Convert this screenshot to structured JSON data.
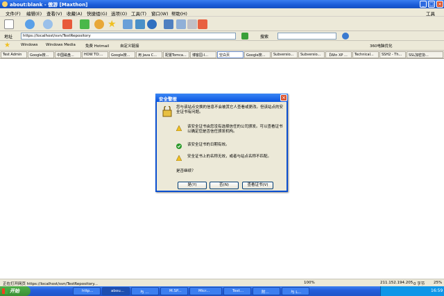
{
  "window": {
    "title": "about:blank - 傲游 [Maxthon]",
    "controls": [
      "_",
      "□",
      "×"
    ]
  },
  "menu": [
    "文件(F)",
    "编辑(E)",
    "查看(V)",
    "收藏(A)",
    "快捷组(G)",
    "选项(O)",
    "工具(T)",
    "窗口(W)",
    "帮助(H)"
  ],
  "menu_right": "工具",
  "address": {
    "label": "地址",
    "value": "https://localhost/svn/TestRepository",
    "search_label": "搜索"
  },
  "favorites": [
    "Windows",
    "Windows Media",
    "免费 Hotmail",
    "自定义链接"
  ],
  "favorites_right": "360电脑优化",
  "tabs": [
    "Test Admin",
    "Google搜...",
    "中国磁盘...",
    "HOW TO:...",
    "Google搜...",
    "用 Java C...",
    "配置Tomca...",
    "博客园-I...",
    "空白页",
    "Google搜...",
    "Subversio...",
    "Subversio...",
    "【Win XP ...",
    "Technical...",
    "SSH2 - Th...",
    "SSL加密协..."
  ],
  "dialog": {
    "title": "安全警报",
    "intro": "您与该站点交换的信息不会被其它人查看或更改。但该站点的安全证书有问题。",
    "items": [
      {
        "icon": "warning-icon",
        "text": "该安全证书由您没有选择信任的公司颁发。可以查看证书以确定您是否信任颁发机构。"
      },
      {
        "icon": "check-icon",
        "text": "该安全证书的日期有效。"
      },
      {
        "icon": "warning-icon",
        "text": "安全证书上的名称无效，或者与站点名称不匹配。"
      }
    ],
    "question": "是否继续？",
    "buttons": {
      "yes": "是(Y)",
      "no": "否(N)",
      "view": "查看证书(V)"
    }
  },
  "status": {
    "text": "正在打开网页 https://localhost/svn/TestRepository...",
    "zoom": "100%",
    "ip": "211.152.194.205",
    "speed": "0 字节",
    "rate": "25%"
  },
  "taskbar": {
    "start": "开始",
    "tasks": [
      "http...",
      "abou...",
      "与 ...",
      "M.SP...",
      "Micr...",
      "Test...",
      "附...",
      "与 L..."
    ],
    "time": "16:59"
  },
  "colors": {
    "title_blue": "#1a5cd8",
    "taskbar_blue": "#245edb",
    "start_green": "#3a8e34",
    "dialog_border": "#0a4fd0"
  }
}
